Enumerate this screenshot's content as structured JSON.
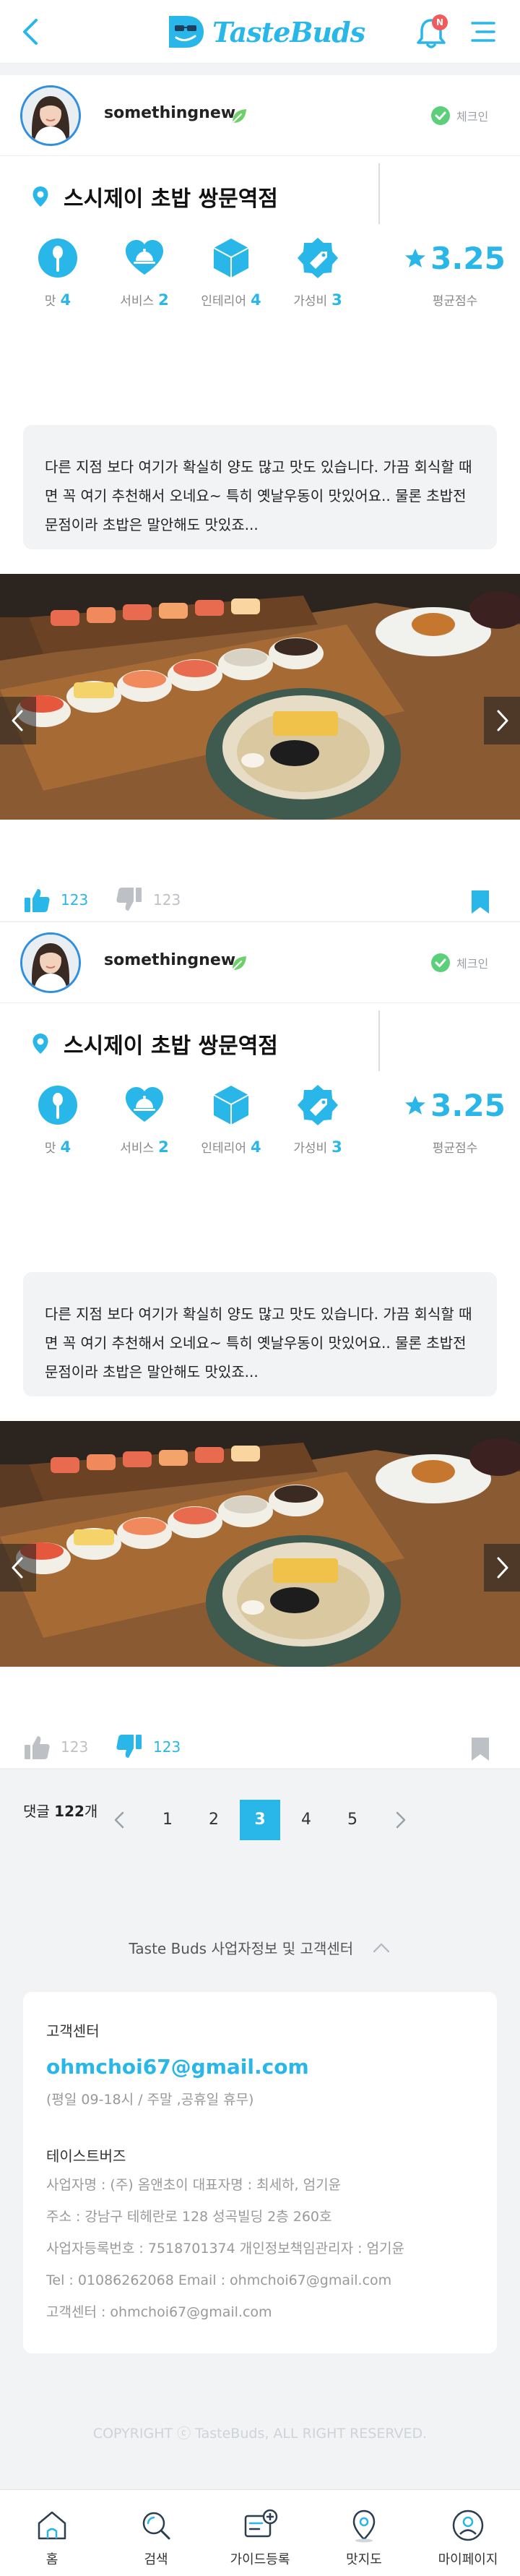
{
  "header": {
    "brand": "TasteBuds",
    "notification_badge": "N"
  },
  "reviews": [
    {
      "username": "somethingnew",
      "checkin_label": "체크인",
      "place": "스시제이 초밥 쌍문역점",
      "ratings": [
        {
          "label": "맛",
          "score": "4",
          "icon": "spoon-icon"
        },
        {
          "label": "서비스",
          "score": "2",
          "icon": "heart-cloche-icon"
        },
        {
          "label": "인테리어",
          "score": "4",
          "icon": "cube-icon"
        },
        {
          "label": "가성비",
          "score": "3",
          "icon": "price-tag-icon"
        }
      ],
      "average": {
        "value": "3.25",
        "label": "평균점수"
      },
      "text": "다른 지점 보다 여기가 확실히 양도 많고 맛도 있습니다. 가끔 회식할 때면 꼭 여기 추천해서 오네요~ 특히 옛날우동이 맛있어요.. 물론 초밥전문점이라 초밥은 말안해도 맛있죠...",
      "likes": "123",
      "dislikes": "123",
      "liked": true,
      "disliked": false,
      "bookmarked": true,
      "comments_prefix": "댓글 ",
      "comments_count": "122",
      "comments_suffix": "개"
    },
    {
      "username": "somethingnew",
      "checkin_label": "체크인",
      "place": "스시제이 초밥 쌍문역점",
      "ratings": [
        {
          "label": "맛",
          "score": "4",
          "icon": "spoon-icon"
        },
        {
          "label": "서비스",
          "score": "2",
          "icon": "heart-cloche-icon"
        },
        {
          "label": "인테리어",
          "score": "4",
          "icon": "cube-icon"
        },
        {
          "label": "가성비",
          "score": "3",
          "icon": "price-tag-icon"
        }
      ],
      "average": {
        "value": "3.25",
        "label": "평균점수"
      },
      "text": "다른 지점 보다 여기가 확실히 양도 많고 맛도 있습니다. 가끔 회식할 때면 꼭 여기 추천해서 오네요~ 특히 옛날우동이 맛있어요.. 물론 초밥전문점이라 초밥은 말안해도 맛있죠...",
      "likes": "123",
      "dislikes": "123",
      "liked": false,
      "disliked": true,
      "bookmarked": false,
      "comments_prefix": "댓글 ",
      "comments_count": "122",
      "comments_suffix": "개"
    }
  ],
  "pagination": {
    "pages": [
      "1",
      "2",
      "3",
      "4",
      "5"
    ],
    "current": "3"
  },
  "footer": {
    "toggle_label": "Taste Buds 사업자정보 및 고객센터",
    "cs_title": "고객센터",
    "cs_email": "ohmchoi67@gmail.com",
    "cs_hours": "(평일 09-18시 / 주말 ,공휴일 휴무)",
    "company_name": "테이스트버즈",
    "company_lines": [
      "사업자명 : (주) 옴앤초이    대표자명 : 최세하, 엄기윤",
      "주소 : 강남구 테헤란로 128 성곡빌딩 2층 260호",
      "사업자등록번호 : 7518701374    개인정보책임관리자 : 엄기윤",
      "Tel : 01086262068    Email : ohmchoi67@gmail.com",
      "고객센터 : ohmchoi67@gmail.com"
    ],
    "copyright": "COPYRIGHT ⓒ TasteBuds, ALL RIGHT RESERVED."
  },
  "bottom_nav": [
    {
      "label": "홈",
      "icon": "home-icon"
    },
    {
      "label": "검색",
      "icon": "search-icon"
    },
    {
      "label": "가이드등록",
      "icon": "guide-register-icon"
    },
    {
      "label": "맛지도",
      "icon": "map-pin-icon"
    },
    {
      "label": "마이페이지",
      "icon": "profile-icon"
    }
  ],
  "colors": {
    "accent": "#29b6e8",
    "accent_dark": "#2f8fe0",
    "checkin_green": "#5ccf7a",
    "leaf_green": "#6fcf6b",
    "badge_red": "#f25b5b",
    "inactive_gray": "#bdc1c6"
  }
}
